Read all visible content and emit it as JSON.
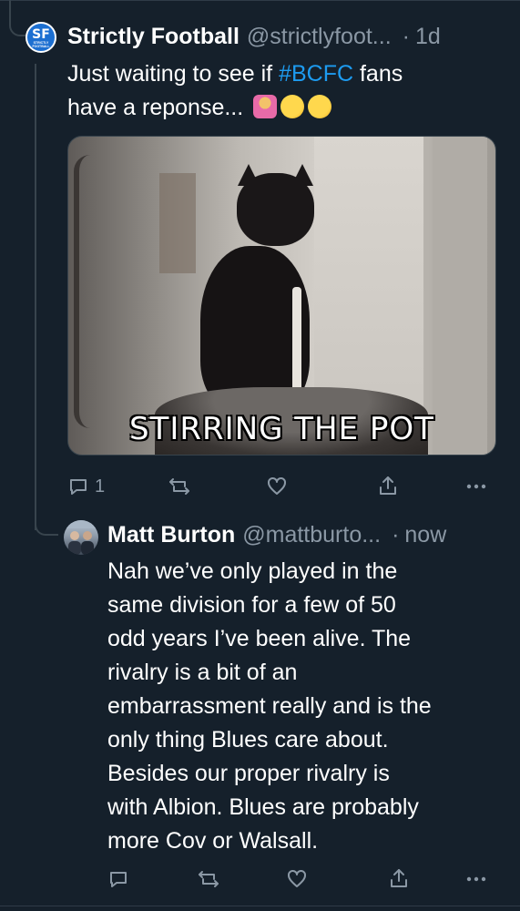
{
  "tweet1": {
    "avatar_letters": "SF",
    "avatar_subtext": "STRICTLY FOOTBALL",
    "name": "Strictly Football",
    "handle": "@strictlyfoot...",
    "separator": "·",
    "time": "1d",
    "text_before": "Just waiting to see if ",
    "hashtag": "#BCFC",
    "text_after": " fans",
    "text_line2": "have a reponse...",
    "emojis": [
      "person-shrugging-emoji",
      "thinking-face-emoji",
      "rolling-laughing-emoji"
    ],
    "media": {
      "type": "gif",
      "caption": "STIRRING THE POT"
    },
    "actions": {
      "reply_count": "1"
    }
  },
  "tweet2": {
    "name": "Matt Burton",
    "handle": "@mattburto...",
    "separator": "·",
    "time": "now",
    "text_lines": [
      "Nah we’ve only played in the",
      "same division for a few of 50",
      "odd years I’ve been alive. The",
      "rivalry is a bit of an",
      "embarrassment really and is the",
      "only thing Blues care about.",
      "Besides our proper rivalry is",
      "with Albion. Blues are probably",
      "more Cov or Walsall."
    ]
  },
  "colors": {
    "background": "#15202b",
    "text": "#ffffff",
    "muted": "#8b98a5",
    "link": "#1d9bf0",
    "divider": "#38444d"
  }
}
